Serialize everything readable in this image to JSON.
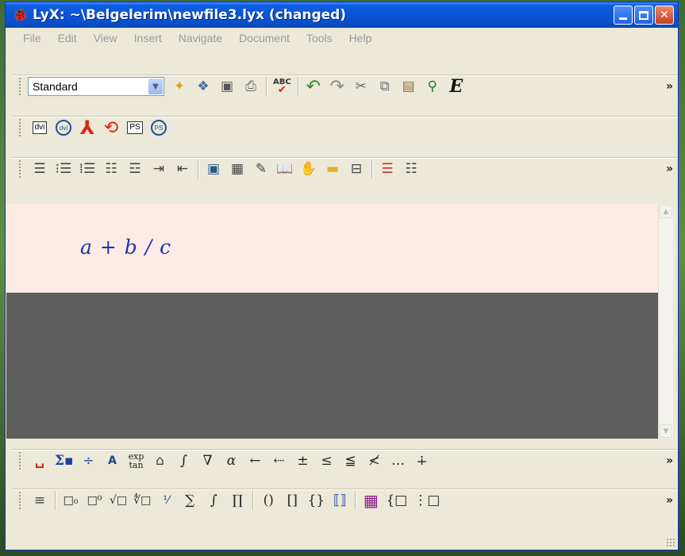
{
  "window": {
    "title": "LyX: ~\\Belgelerim\\newfile3.lyx (changed)",
    "app_icon": "lyx-icon",
    "buttons": [
      "minimize",
      "maximize",
      "close"
    ]
  },
  "menu": [
    "File",
    "Edit",
    "View",
    "Insert",
    "Navigate",
    "Document",
    "Tools",
    "Help"
  ],
  "toolbar_main": {
    "layout_select": {
      "value": "Standard"
    },
    "icons": [
      "new-document-icon",
      "open-icon",
      "save-icon",
      "print-icon",
      "spellcheck-icon",
      "undo-icon",
      "redo-icon",
      "cut-icon",
      "copy-icon",
      "paste-icon",
      "find-replace-icon",
      "emphasis-icon"
    ],
    "spellcheck_label": "ABC",
    "emph_label": "E",
    "more": "»"
  },
  "toolbar_view": {
    "dvi_label": "dvi",
    "dvi_update_label": "dvi",
    "ps_label": "PS",
    "ps_update_label": "PS"
  },
  "toolbar_paragraph": {
    "icons": [
      "align-icon",
      "numbered-list-icon",
      "bullet-list-icon",
      "description-list-icon",
      "list-icon",
      "indent-icon",
      "unindent-icon",
      "insert-graphics-icon",
      "insert-table-icon",
      "insert-note-icon",
      "toc-icon",
      "hand-icon",
      "folder-icon",
      "label-icon",
      "paragraph-settings-icon",
      "document-settings-icon"
    ],
    "more": "»"
  },
  "document": {
    "formula": "a + b / c"
  },
  "math_toolbar_1": {
    "symbols": [
      "␣",
      "Σ",
      "÷",
      "A",
      "exp tan",
      "⌂",
      "∫",
      "∇",
      "α",
      "←",
      "⇠",
      "±",
      "≤",
      "≦",
      "≮",
      "…",
      "∔"
    ],
    "exp_label": "exp",
    "tan_label": "tan",
    "more": "»"
  },
  "math_toolbar_2": {
    "symbols": [
      "≡",
      "□₀",
      "□⁰",
      "√□",
      "∜□",
      "a/b",
      "∑",
      "∫",
      "∏",
      "()",
      "[]",
      "{}",
      "[[]]",
      "▦",
      "{□",
      "⋮□"
    ],
    "more": "»"
  }
}
